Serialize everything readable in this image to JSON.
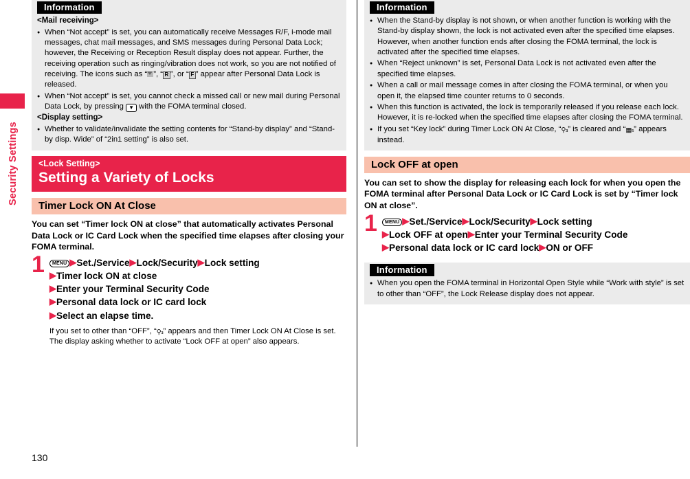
{
  "sidebar": {
    "chapter_label": "Security Settings",
    "page_number": "130"
  },
  "left_column": {
    "info_top": {
      "badge": "Information",
      "sub_heading_1": "<Mail receiving>",
      "items": [
        "When “Not accept” is set, you can automatically receive Messages R/F, i-mode mail messages, chat mail messages, and SMS messages during Personal Data Lock; however, the Receiving or Reception Result display does not appear. Further, the receiving operation such as ringing/vibration does not work, so you are not notified of receiving. The icons such as “",
        "When “Not accept” is set, you cannot check a missed call or new mail during Personal Data Lock, by pressing "
      ],
      "item1_tail_a": "”, “",
      "item1_tail_b": "”, or “",
      "item1_tail_c": "” appear after Personal Data Lock is released.",
      "item2_tail": " with the FOMA terminal closed.",
      "icon_mail": "mail-icon",
      "icon_r": "R",
      "icon_f": "F",
      "icon_down_key": "▼",
      "sub_heading_2": "<Display setting>",
      "item3": "Whether to validate/invalidate the setting contents for “Stand-by display” and “Stand-by disp. Wide” of “2in1 setting” is also set."
    },
    "chapter": {
      "kicker": "<Lock Setting>",
      "title": "Setting a Variety of Locks"
    },
    "section": {
      "heading": "Timer Lock ON At Close",
      "lead": "You can set “Timer lock ON at close” that automatically activates Personal Data Lock or IC Card Lock when the specified time elapses after closing your FOMA terminal.",
      "step_number": "1",
      "menu_key_label": "MENU",
      "step_lines": [
        [
          "Set./Service",
          "Lock/Security",
          "Lock setting"
        ],
        [
          "Timer lock ON at close"
        ],
        [
          "Enter your Terminal Security Code"
        ],
        [
          "Personal data lock or IC card lock"
        ],
        [
          "Select an elapse time."
        ]
      ],
      "note_head": "If you set to other than “OFF”, “",
      "note_tail": "” appears and then Timer Lock ON At Close is set. The display asking whether to activate “Lock OFF at open” also appears.",
      "note_icon": "timer-lock-icon"
    }
  },
  "right_column": {
    "info_top": {
      "badge": "Information",
      "items": [
        "When the Stand-by display is not shown, or when another function is working with the Stand-by display shown, the lock is not activated even after the specified time elapses. However, when another function ends after closing the FOMA terminal, the lock is activated after the specified time elapses.",
        "When “Reject unknown” is set, Personal Data Lock is not activated even after the specified time elapses.",
        "When a call or mail message comes in after closing the FOMA terminal, or when you open it, the elapsed time counter returns to 0 seconds.",
        "When this function is activated, the lock is temporarily released if you release each lock. However, it is re-locked when the specified time elapses after closing the FOMA terminal."
      ],
      "item_key_lock_head": "If you set “Key lock” during Timer Lock ON At Close, “",
      "item_key_lock_mid": "” is cleared and “",
      "item_key_lock_tail": "” appears instead.",
      "icon_timer_lock": "timer-lock-icon",
      "icon_key_lock": "key-lock-icon"
    },
    "section": {
      "heading": "Lock OFF at open",
      "lead": "You can set to show the display for releasing each lock for when you open the FOMA terminal after Personal Data Lock or IC Card Lock is set by “Timer lock ON at close”.",
      "step_number": "1",
      "menu_key_label": "MENU",
      "step_lines": [
        [
          "Set./Service",
          "Lock/Security",
          "Lock setting"
        ],
        [
          "Lock OFF at open",
          "Enter your Terminal Security Code"
        ],
        [
          "Personal data lock or IC card lock",
          "ON or OFF"
        ]
      ]
    },
    "info_bottom": {
      "badge": "Information",
      "items": [
        "When you open the FOMA terminal in Horizontal Open Style while “Work with style” is set to other than “OFF”, the Lock Release display does not appear."
      ]
    }
  },
  "colors": {
    "accent_red": "#e8234a",
    "section_peach": "#f9c0ac",
    "info_gray": "#ebebeb",
    "badge_black": "#000000"
  }
}
